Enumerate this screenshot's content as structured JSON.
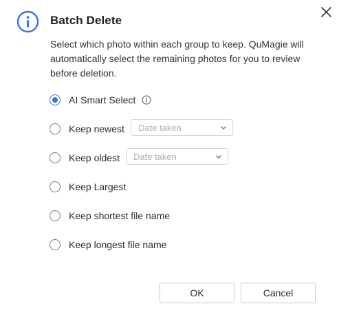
{
  "dialog": {
    "title": "Batch Delete",
    "description": "Select which photo within each group to keep. QuMagie will automatically select the remaining photos for you to review before deletion.",
    "accent_color": "#3b73e5"
  },
  "options": [
    {
      "label": "AI Smart Select",
      "checked": true,
      "has_info_icon": true
    },
    {
      "label": "Keep newest",
      "checked": false,
      "select_value": "Date taken"
    },
    {
      "label": "Keep oldest",
      "checked": false,
      "select_value": "Date taken"
    },
    {
      "label": "Keep Largest",
      "checked": false
    },
    {
      "label": "Keep shortest file name",
      "checked": false
    },
    {
      "label": "Keep longest file name",
      "checked": false
    }
  ],
  "buttons": {
    "ok_label": "OK",
    "cancel_label": "Cancel"
  },
  "icons": {
    "header": "info-circle-icon",
    "close": "close-icon",
    "option_info": "info-icon",
    "dropdown": "chevron-down-icon"
  }
}
